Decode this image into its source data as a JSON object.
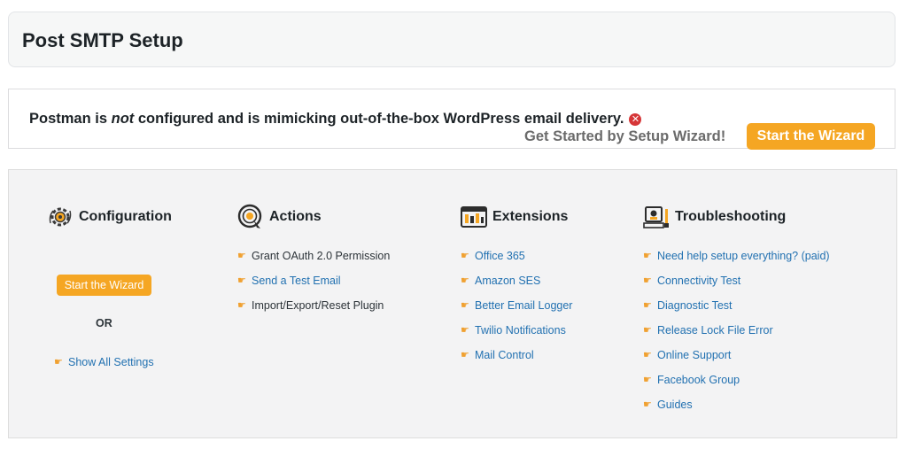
{
  "header": {
    "title": "Post SMTP Setup"
  },
  "notice": {
    "message_prefix": "Postman is ",
    "message_emph": "not",
    "message_suffix": " configured and is mimicking out-of-the-box WordPress email delivery.",
    "error_icon": "close-circle-icon",
    "wizard_prompt": "Get Started by Setup Wizard!",
    "wizard_button": "Start the Wizard"
  },
  "configuration": {
    "title": "Configuration",
    "icon": "gear-icon",
    "wizard_button": "Start the Wizard",
    "or_label": "OR",
    "show_all_settings": "Show All Settings"
  },
  "actions": {
    "title": "Actions",
    "icon": "target-icon",
    "items": [
      "Grant OAuth 2.0 Permission",
      "Send a Test Email",
      "Import/Export/Reset Plugin"
    ]
  },
  "extensions": {
    "title": "Extensions",
    "icon": "extensions-icon",
    "items": [
      "Office 365",
      "Amazon SES",
      "Better Email Logger",
      "Twilio Notifications",
      "Mail Control"
    ]
  },
  "troubleshooting": {
    "title": "Troubleshooting",
    "icon": "toolbox-icon",
    "items": [
      "Need help setup everything? (paid)",
      "Connectivity Test",
      "Diagnostic Test",
      "Release Lock File Error",
      "Online Support",
      "Facebook Group",
      "Guides"
    ]
  },
  "colors": {
    "accent": "#f5a623",
    "link": "#2271b1",
    "error": "#d63638"
  }
}
